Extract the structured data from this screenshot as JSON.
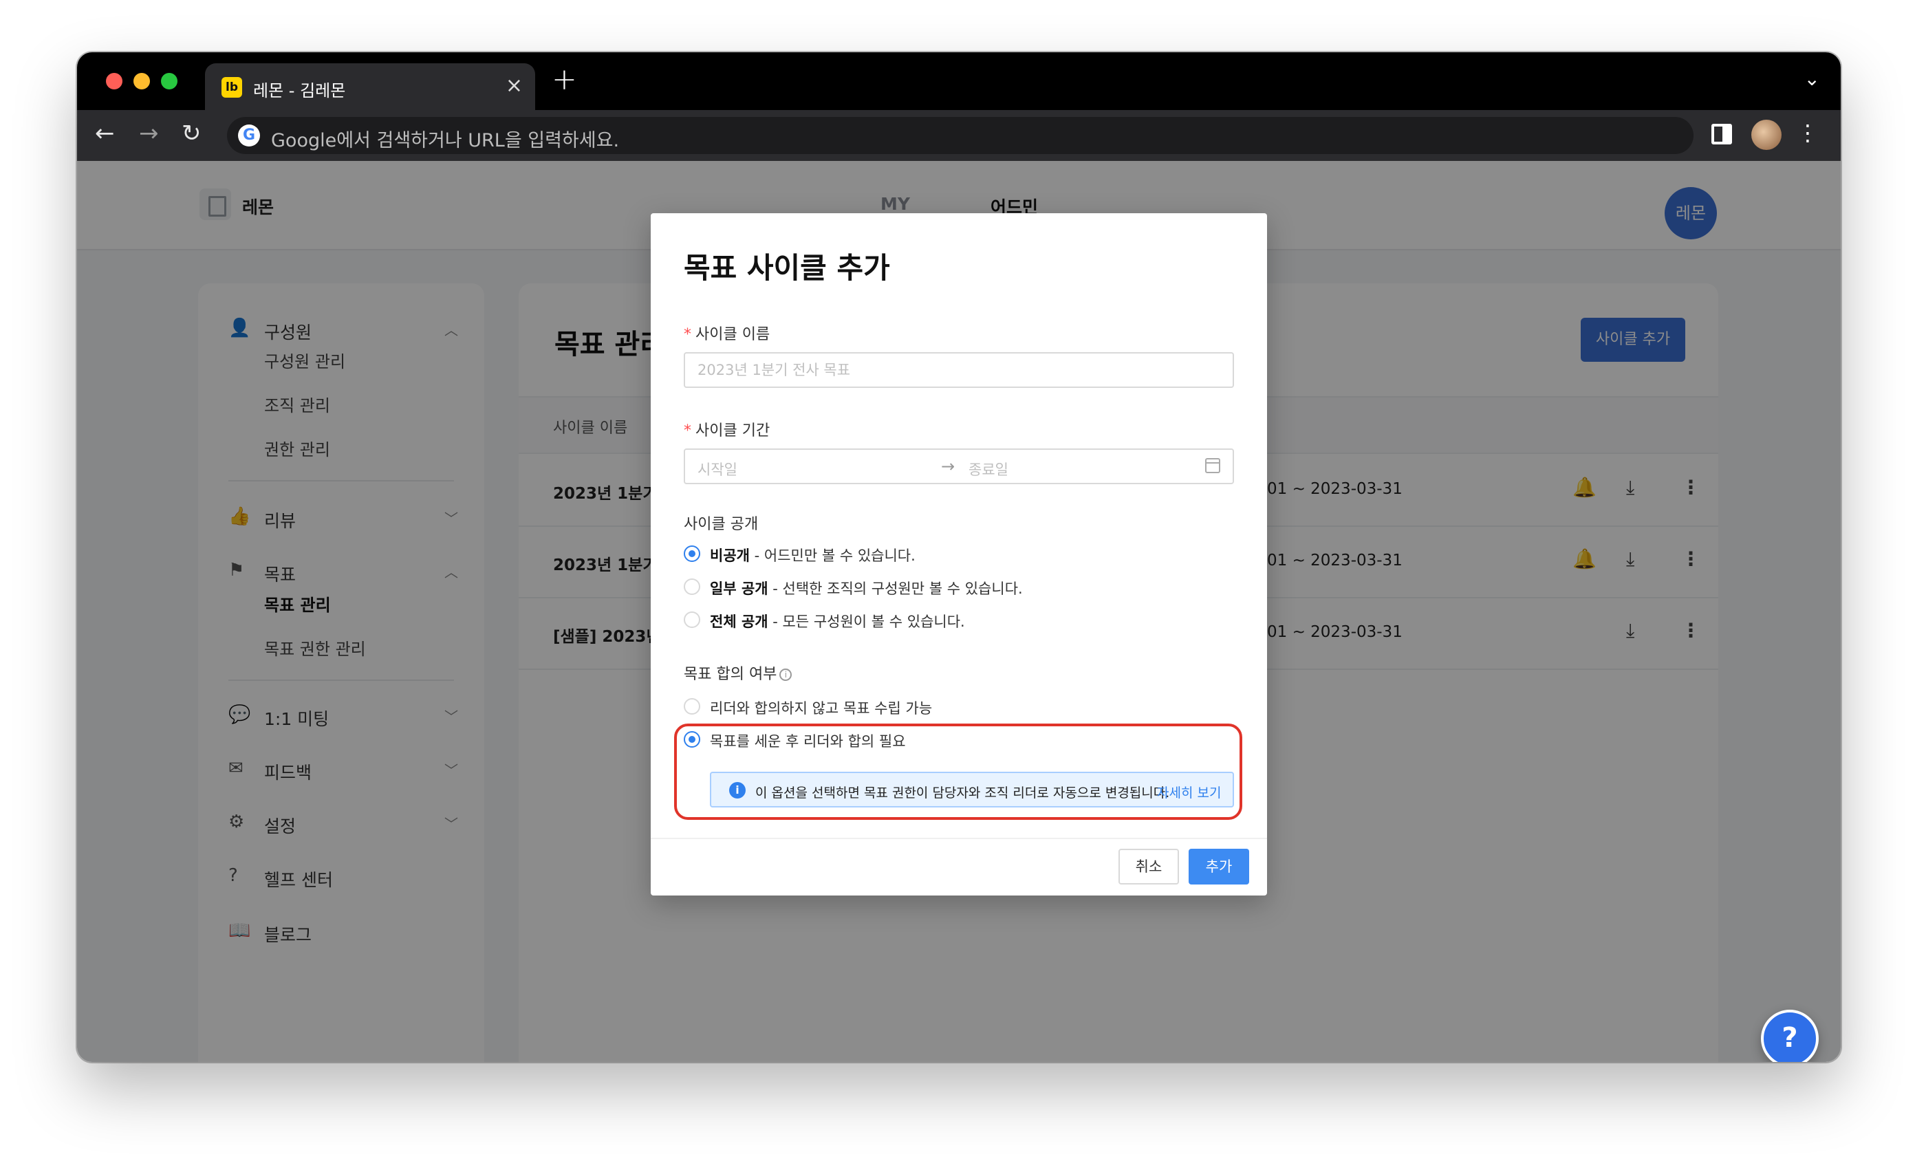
{
  "browser": {
    "tab_title": "레몬 - 김레몬",
    "tab_favicon_text": "lb",
    "omnibox_placeholder": "Google에서 검색하거나 URL을 입력하세요.",
    "google_letter": "G"
  },
  "header": {
    "org_name": "레몬",
    "nav_tabs": [
      {
        "label": "MY",
        "active": false
      },
      {
        "label": "어드민",
        "active": true
      }
    ],
    "user_avatar_text": "레몬"
  },
  "sidebar": {
    "sections": [
      {
        "icon": "person-icon",
        "label": "구성원",
        "expanded": true,
        "items": [
          "구성원 관리",
          "조직 관리",
          "권한 관리"
        ]
      },
      {
        "icon": "thumbs-up-icon",
        "label": "리뷰",
        "expanded": false
      },
      {
        "icon": "flag-icon",
        "label": "목표",
        "expanded": true,
        "items": [
          "목표 관리",
          "목표 권한 관리"
        ],
        "active_item": "목표 관리"
      },
      {
        "icon": "chat-icon",
        "label": "1:1 미팅",
        "expanded": false
      },
      {
        "icon": "mail-icon",
        "label": "피드백",
        "expanded": false
      },
      {
        "icon": "gear-icon",
        "label": "설정",
        "expanded": false
      },
      {
        "icon": "help-circle-icon",
        "label": "헬프 센터"
      },
      {
        "icon": "book-icon",
        "label": "블로그"
      }
    ]
  },
  "main": {
    "title": "목표 관리",
    "add_button_label": "사이클 추가",
    "table": {
      "column_name": "사이클 이름",
      "rows": [
        {
          "name": "2023년 1분기",
          "period": "01 ~ 2023-03-31",
          "has_bell": true
        },
        {
          "name": "2023년 1분기",
          "period": "01 ~ 2023-03-31",
          "has_bell": true
        },
        {
          "name": "[샘플] 2023년",
          "period": "01 ~ 2023-03-31",
          "has_bell": false
        }
      ]
    }
  },
  "modal": {
    "title": "목표 사이클 추가",
    "cycle_name": {
      "label": "사이클 이름",
      "placeholder": "2023년 1분기 전사 목표"
    },
    "cycle_period": {
      "label": "사이클 기간",
      "start_placeholder": "시작일",
      "end_placeholder": "종료일"
    },
    "visibility": {
      "label": "사이클 공개",
      "options": [
        {
          "bold": "비공개",
          "desc": " - 어드민만 볼 수 있습니다.",
          "checked": true
        },
        {
          "bold": "일부 공개",
          "desc": " - 선택한 조직의 구성원만 볼 수 있습니다.",
          "checked": false
        },
        {
          "bold": "전체 공개",
          "desc": " - 모든 구성원이 볼 수 있습니다.",
          "checked": false
        }
      ]
    },
    "agreement": {
      "label": "목표 합의 여부",
      "info_glyph": "i",
      "options": [
        {
          "label": "리더와 합의하지 않고 목표 수립 가능",
          "checked": false
        },
        {
          "label": "목표를 세운 후 리더와 합의 필요",
          "checked": true
        }
      ],
      "alert_text": "이 옵션을 선택하면 목표 권한이 담당자와 조직 리더로 자동으로 변경됩니다.",
      "alert_link": "자세히 보기"
    },
    "cancel_label": "취소",
    "add_label": "추가"
  },
  "help_fab_label": "?",
  "colors": {
    "primary": "#3b6fd4",
    "modal_primary": "#3d8bf2",
    "highlight": "#e0342a",
    "alert_bg": "#e8f3ff"
  }
}
